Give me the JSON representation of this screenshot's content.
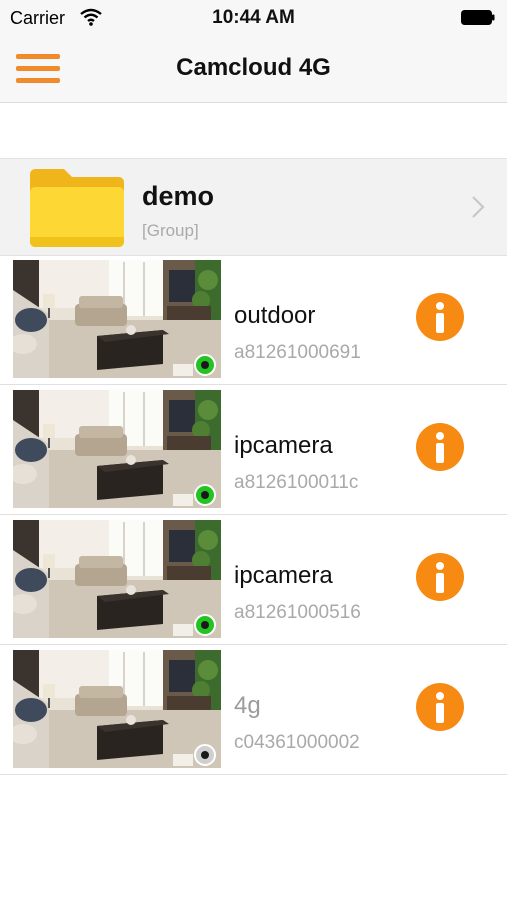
{
  "status_bar": {
    "carrier": "Carrier",
    "time": "10:44 AM"
  },
  "header": {
    "title": "Camcloud 4G",
    "accent_color": "#f08a2a"
  },
  "group": {
    "name": "demo",
    "type": "[Group]"
  },
  "cameras": [
    {
      "name": "outdoor",
      "id": "a81261000691",
      "status": "online",
      "status_color": "#22c322"
    },
    {
      "name": "ipcamera",
      "id": "a8126100011c",
      "status": "online",
      "status_color": "#22c322"
    },
    {
      "name": "ipcamera",
      "id": "a81261000516",
      "status": "online",
      "status_color": "#22c322"
    },
    {
      "name": "4g",
      "id": "c04361000002",
      "status": "offline",
      "status_color": "#cfcfcf"
    }
  ],
  "icons": {
    "menu": "hamburger-icon",
    "folder": "folder-icon",
    "chevron": "chevron-right-icon",
    "info": "info-icon",
    "status": "status-dot-icon"
  }
}
